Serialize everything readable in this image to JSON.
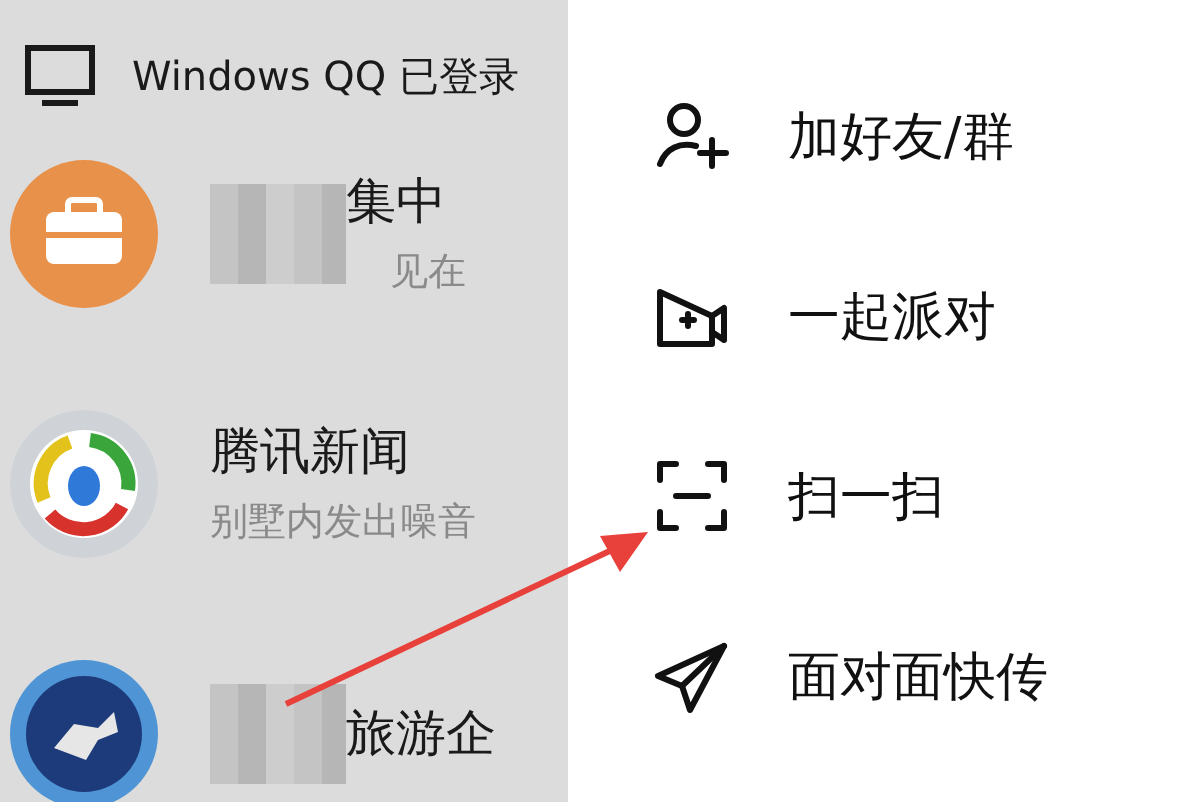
{
  "device_banner": {
    "label": "Windows QQ 已登录"
  },
  "chats": [
    {
      "kind": "briefcase",
      "title": "集中",
      "subtitle": "见在",
      "blurred": true
    },
    {
      "kind": "news",
      "title": "腾讯新闻",
      "subtitle": "别墅内发出噪音",
      "blurred": false
    },
    {
      "kind": "emblem",
      "title": "旅游企",
      "blurred": true
    }
  ],
  "menu": {
    "items": [
      {
        "kind": "add-friend",
        "label": "加好友/群"
      },
      {
        "kind": "party",
        "label": "一起派对"
      },
      {
        "kind": "scan",
        "label": "扫一扫"
      },
      {
        "kind": "send",
        "label": "面对面快传"
      }
    ]
  }
}
